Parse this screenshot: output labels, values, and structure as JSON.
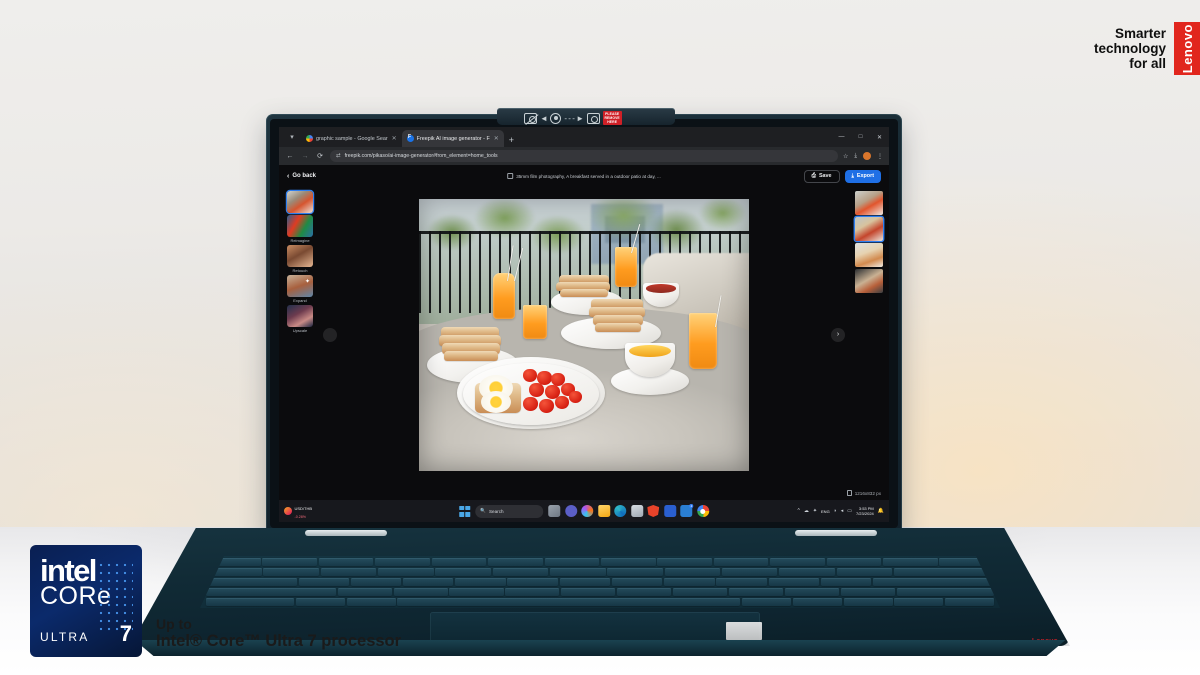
{
  "branding": {
    "lenovo_tagline_line1": "Smarter",
    "lenovo_tagline_line2": "technology",
    "lenovo_tagline_line3": "for all",
    "lenovo_logo": "Lenovo",
    "intel_badge": {
      "brand": "intel",
      "family": "CORe",
      "tier": "ULTRA",
      "number": "7"
    },
    "intel_caption_line1": "Up to",
    "intel_caption_line2": "Intel® Core™ Ultra 7 processor",
    "accent_red": "#e1261d",
    "accent_intel_blue": "#0b2a6b"
  },
  "webcam_bar": {
    "privacy_badge_line1": "PLEASE",
    "privacy_badge_line2": "REMOVE",
    "privacy_badge_line3": "HERE",
    "icons": [
      "camera-blocked-icon",
      "arrow-right-dashed-icon",
      "camera-icon"
    ]
  },
  "browser": {
    "tabs": [
      {
        "title": "graphic sample - Google Sear",
        "favicon": "google-favicon",
        "active": false
      },
      {
        "title": "Freepik AI image generator - F",
        "favicon": "freepik-favicon",
        "active": true
      }
    ],
    "new_tab_label": "+",
    "tab_search_icon": "chevron-down-icon",
    "window_controls": {
      "minimize": "—",
      "maximize": "□",
      "close": "✕"
    },
    "nav": {
      "back": "←",
      "forward": "→",
      "reload": "⟳"
    },
    "omnibox": {
      "site_icon": "site-settings-icon",
      "url": "freepik.com/pikaso/ai-image-generator#from_element=home_tools"
    },
    "omnibox_actions": {
      "bookmark": "☆",
      "downloads": "download-icon",
      "profile": "L",
      "menu": "⋮"
    }
  },
  "app": {
    "go_back_label": "Go back",
    "prompt_text": "35mm film photography, A breakfast served in a outdoor patio at day, ...",
    "prompt_icon": "image-icon",
    "save_label": "Save",
    "save_icon": "save-icon",
    "export_label": "Export",
    "export_icon": "export-icon",
    "export_color": "#1f6fe5",
    "tools": [
      {
        "label": "",
        "name": "current-image",
        "selected": true
      },
      {
        "label": "Reimagine",
        "name": "reimagine",
        "selected": false
      },
      {
        "label": "Retouch",
        "name": "retouch",
        "selected": false
      },
      {
        "label": "Expand",
        "name": "expand",
        "selected": false
      },
      {
        "label": "Upscale",
        "name": "upscale",
        "selected": false
      }
    ],
    "nav_prev_icon": "chevron-left-icon",
    "nav_next_icon": "chevron-right-icon",
    "variations": [
      {
        "name": "variation-1",
        "selected": false
      },
      {
        "name": "variation-2",
        "selected": true
      },
      {
        "name": "variation-3",
        "selected": false
      },
      {
        "name": "variation-4",
        "selected": false
      }
    ],
    "image_dimensions": "1216x832 px",
    "image_subject": "breakfast on an outdoor patio table: stacked toast, orange juice, strawberries, fried egg, coffee cups"
  },
  "taskbar": {
    "widget": {
      "title": "USD/THB",
      "change": "-0.28%"
    },
    "start_icon": "windows-start-icon",
    "search_placeholder": "Search",
    "search_icon": "search-icon",
    "apps": [
      "task-view-icon",
      "teams-icon",
      "copilot-icon",
      "file-explorer-icon",
      "edge-icon",
      "store-icon",
      "brave-icon",
      "vivaldi-icon",
      "vscode-icon",
      "chrome-icon"
    ],
    "vscode_badge": "1",
    "tray": {
      "overflow": "^",
      "icons": [
        "onedrive-icon",
        "bluetooth-icon"
      ],
      "language": "ENG",
      "network": "wifi-icon",
      "volume": "volume-icon",
      "battery": "battery-icon",
      "notifications": "bell-icon"
    },
    "clock": {
      "time": "3:53 PM",
      "date": "7/23/2024"
    }
  }
}
